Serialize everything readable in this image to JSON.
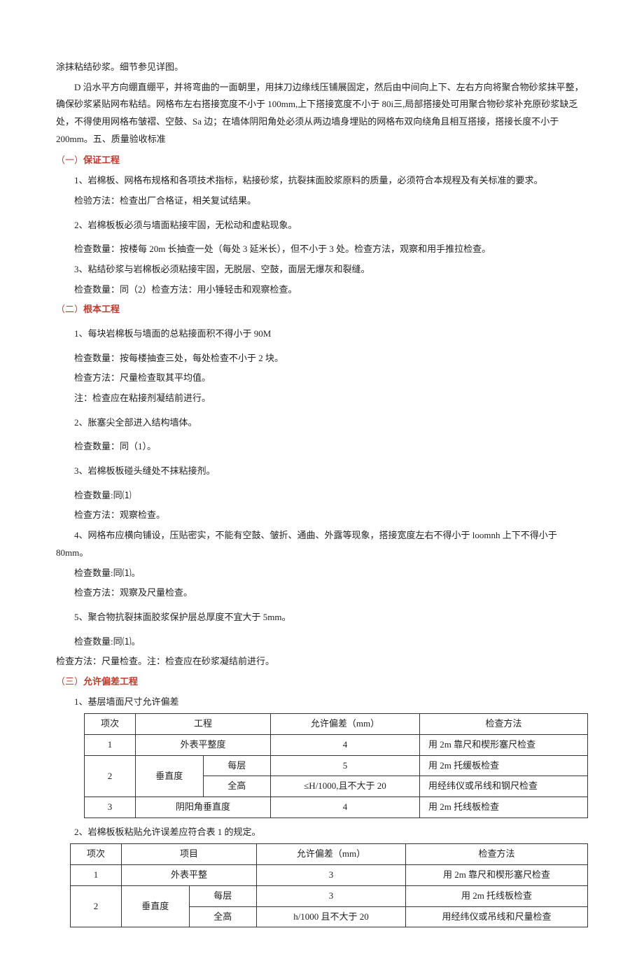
{
  "intro": {
    "p1": "涂抹粘结砂浆。细节参见详图。",
    "p2": "D 沿水平方向绷直绷平，并将弯曲的一面朝里，用抹刀边缘线压铺展固定，然后由中间向上下、左右方向将聚合物砂浆抹平整，确保砂浆紧贴网布粘结。网格布左右搭接宽度不小于 100mm,上下搭接宽度不小于 80i三,局部搭接处可用聚合物砂浆补充原砂浆缺乏处，不得使用网格布皱褶、空鼓、Sa 边；在墙体阴阳角处必须从两边墙身埋贴的网格布双向绕角且相互搭接，搭接长度不小于 200mm。五、质量验收标准"
  },
  "sec1": {
    "title": "（一）保证工程",
    "p1": "1、岩棉板、网格布规格和各项技术指标，粘接砂浆，抗裂抹面胶浆原料的质量，必须符合本规程及有关标准的要求。",
    "p2": "检验方法：检查出厂合格证，相关复试结果。",
    "p3": "2、岩棉板板必须与墙面粘接牢固，无松动和虚粘现象。",
    "p4": "检查数量：按楼每 20m 长抽查一处（每处 3 延米长），但不小于 3 处。检查方法，观察和用手推拉检查。",
    "p5": "3、粘结砂浆与岩棉板必须粘接牢固，无脱层、空鼓，面层无爆灰和裂缝。",
    "p6": "检查数量：同（2）检查方法：用小锤轻击和观察检查。"
  },
  "sec2": {
    "title": "（二）根本工程",
    "p1": "1、每块岩棉板与墙面的总粘接面积不得小于 90M",
    "p2": "检查数量：按每楼抽查三处，每处检查不小于 2 块。",
    "p3": "检查方法：尺量检查取其平均值。",
    "p4": "注：检查应在粘接剂凝结前进行。",
    "p5": "2、胀塞尖全部进入结构墙体。",
    "p6": "检查数量：同（1）。",
    "p7": "3、岩棉板板碰头缝处不抹粘接剂。",
    "p8": "检查数量:同⑴",
    "p9": "检查方法：观察检查。",
    "p10": "4、网格布应横向铺设，压贴密实，不能有空鼓、皱折、通曲、外露等现象，搭接宽度左右不得小于 loomnh 上下不得小于 80mm。",
    "p11": "检查数量:同⑴。",
    "p12": "检查方法：观察及尺量检查。",
    "p13": "5、聚合物抗裂抹面胶浆保护层总厚度不宜大于 5mm。",
    "p14": "检查数量:同⑴。",
    "p15": "检查方法：尺量检查。注：检查应在砂浆凝结前进行。"
  },
  "sec3": {
    "title": "（三）允许偏差工程",
    "p1": "1、基层墙面尺寸允许偏差",
    "table1": {
      "headers": [
        "项次",
        "工程",
        "允许偏差（mm）",
        "检查方法"
      ],
      "rows": [
        {
          "n": "1",
          "item": "外表平整度",
          "dev": "4",
          "method": "用 2m 靠尺和楔形塞尺检查"
        },
        {
          "n": "2",
          "item": "垂直度",
          "sub1": {
            "label": "每层",
            "dev": "5",
            "method": "用 2m 托缓板检查"
          },
          "sub2": {
            "label": "全高",
            "dev": "≤H/1000,且不大于 20",
            "method": "用经纬仪或吊线和钢尺检查"
          }
        },
        {
          "n": "3",
          "item": "阴阳角垂直度",
          "dev": "4",
          "method": "用 2m 托线板检查"
        }
      ]
    },
    "p2": "2、岩棉板板粘贴允许误差应符合表 1 的规定。",
    "table2": {
      "headers": [
        "项次",
        "项目",
        "允许偏差（mm）",
        "检查方法"
      ],
      "rows": [
        {
          "n": "1",
          "item": "外表平整",
          "dev": "3",
          "method": "用 2m 靠尺和楔形塞尺检查"
        },
        {
          "n": "2",
          "item": "垂直度",
          "sub1": {
            "label": "每层",
            "dev": "3",
            "method": "用 2m 托线板检查"
          },
          "sub2": {
            "label": "全高",
            "dev": "h/1000 且不大于 20",
            "method": "用经纬仪或吊线和尺量检查"
          }
        }
      ]
    }
  }
}
